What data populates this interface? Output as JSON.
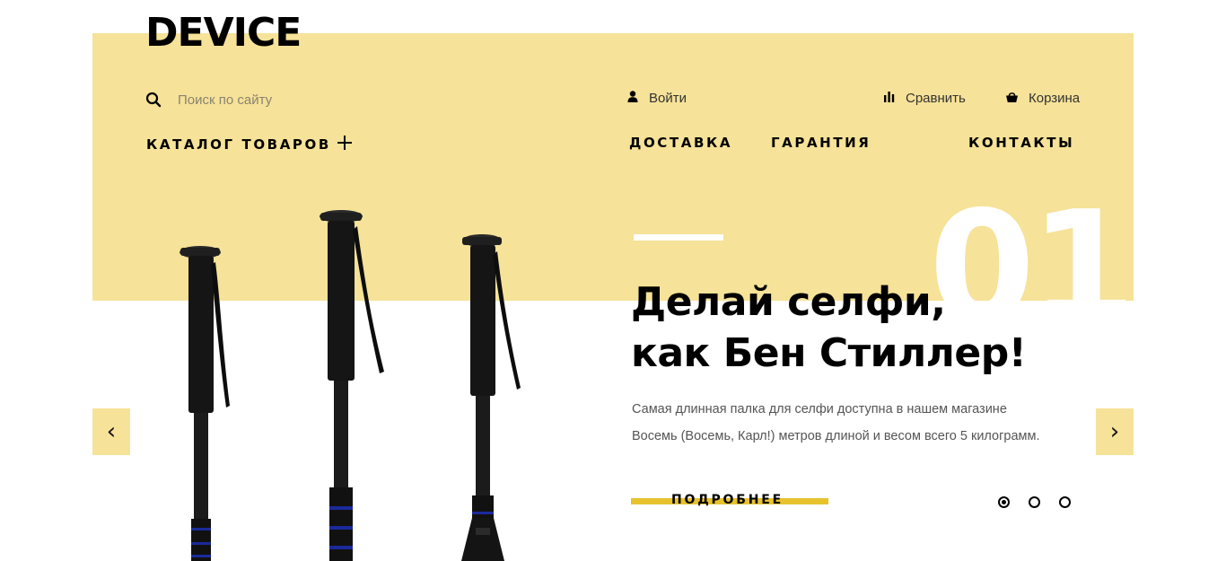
{
  "header": {
    "logo": "DEVICE",
    "search": {
      "placeholder": "Поиск по сайту",
      "value": ""
    },
    "user_nav": {
      "login": "Войти",
      "compare": "Сравнить",
      "cart": "Корзина"
    },
    "main_nav": {
      "catalog": "КАТАЛОГ ТОВАРОВ",
      "delivery": "ДОСТАВКА",
      "warranty": "ГАРАНТИЯ",
      "contacts": "КОНТАКТЫ"
    }
  },
  "slider": {
    "number": "01",
    "title_line1": "Делай селфи,",
    "title_line2": "как Бен Стиллер!",
    "description_line1": "Самая длинная палка для селфи доступна в нашем магазине",
    "description_line2": "Восемь (Восемь, Карл!) метров длиной и весом всего 5 килограмм.",
    "more_button": "ПОДРОБНЕЕ",
    "prev_arrow": "‹",
    "next_arrow": "›",
    "total_slides": 3,
    "active_slide": 1
  },
  "colors": {
    "accent_yellow": "#f6e298",
    "button_underline": "#e7c22d"
  }
}
